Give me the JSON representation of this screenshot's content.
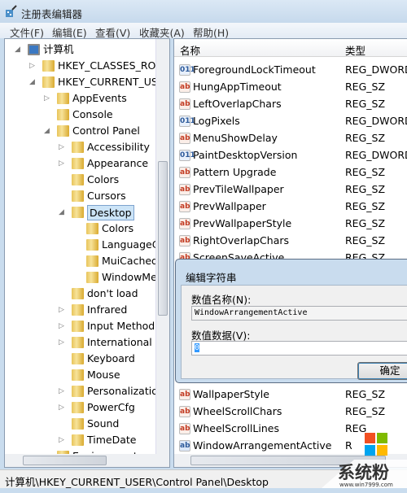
{
  "window": {
    "title": "注册表编辑器"
  },
  "menu": [
    "文件(F)",
    "编辑(E)",
    "查看(V)",
    "收藏夹(A)",
    "帮助(H)"
  ],
  "tree": [
    {
      "label": "计算机",
      "level": 0,
      "toggle": "◢",
      "icon": "computer"
    },
    {
      "label": "HKEY_CLASSES_ROOT",
      "level": 1,
      "toggle": "▷"
    },
    {
      "label": "HKEY_CURRENT_USER",
      "level": 1,
      "toggle": "◢"
    },
    {
      "label": "AppEvents",
      "level": 2,
      "toggle": "▷"
    },
    {
      "label": "Console",
      "level": 2,
      "toggle": ""
    },
    {
      "label": "Control Panel",
      "level": 2,
      "toggle": "◢"
    },
    {
      "label": "Accessibility",
      "level": 3,
      "toggle": "▷"
    },
    {
      "label": "Appearance",
      "level": 3,
      "toggle": "▷"
    },
    {
      "label": "Colors",
      "level": 3,
      "toggle": ""
    },
    {
      "label": "Cursors",
      "level": 3,
      "toggle": ""
    },
    {
      "label": "Desktop",
      "level": 3,
      "toggle": "◢",
      "selected": true
    },
    {
      "label": "Colors",
      "level": 4,
      "toggle": ""
    },
    {
      "label": "LanguageConfiguration",
      "level": 4,
      "toggle": ""
    },
    {
      "label": "MuiCached",
      "level": 4,
      "toggle": ""
    },
    {
      "label": "WindowMetrics",
      "level": 4,
      "toggle": ""
    },
    {
      "label": "don't load",
      "level": 3,
      "toggle": ""
    },
    {
      "label": "Infrared",
      "level": 3,
      "toggle": "▷"
    },
    {
      "label": "Input Method",
      "level": 3,
      "toggle": "▷"
    },
    {
      "label": "International",
      "level": 3,
      "toggle": "▷"
    },
    {
      "label": "Keyboard",
      "level": 3,
      "toggle": ""
    },
    {
      "label": "Mouse",
      "level": 3,
      "toggle": ""
    },
    {
      "label": "Personalization",
      "level": 3,
      "toggle": "▷"
    },
    {
      "label": "PowerCfg",
      "level": 3,
      "toggle": "▷"
    },
    {
      "label": "Sound",
      "level": 3,
      "toggle": ""
    },
    {
      "label": "TimeDate",
      "level": 3,
      "toggle": "▷"
    },
    {
      "label": "Environment",
      "level": 2,
      "toggle": ""
    }
  ],
  "list": {
    "headers": [
      "名称",
      "类型"
    ],
    "rows": [
      {
        "name": "ForegroundLockTimeout",
        "type": "REG_DWORD",
        "icon": "binary"
      },
      {
        "name": "HungAppTimeout",
        "type": "REG_SZ",
        "icon": "string"
      },
      {
        "name": "LeftOverlapChars",
        "type": "REG_SZ",
        "icon": "string"
      },
      {
        "name": "LogPixels",
        "type": "REG_DWORD",
        "icon": "binary"
      },
      {
        "name": "MenuShowDelay",
        "type": "REG_SZ",
        "icon": "string"
      },
      {
        "name": "PaintDesktopVersion",
        "type": "REG_DWORD",
        "icon": "binary"
      },
      {
        "name": "Pattern Upgrade",
        "type": "REG_SZ",
        "icon": "string"
      },
      {
        "name": "PrevTileWallpaper",
        "type": "REG_SZ",
        "icon": "string"
      },
      {
        "name": "PrevWallpaper",
        "type": "REG_SZ",
        "icon": "string"
      },
      {
        "name": "PrevWallpaperStyle",
        "type": "REG_SZ",
        "icon": "string"
      },
      {
        "name": "RightOverlapChars",
        "type": "REG_SZ",
        "icon": "string"
      },
      {
        "name": "ScreenSaveActive",
        "type": "REG_SZ",
        "icon": "string"
      }
    ],
    "rows_after": [
      {
        "name": "WallpaperStyle",
        "type": "REG_SZ",
        "icon": "string"
      },
      {
        "name": "WheelScrollChars",
        "type": "REG_SZ",
        "icon": "string"
      },
      {
        "name": "WheelScrollLines",
        "type": "REG",
        "icon": "string"
      },
      {
        "name": "WindowArrangementActive",
        "type": "R",
        "icon": "string-new"
      }
    ]
  },
  "dialog": {
    "title": "编辑字符串",
    "name_label": "数值名称(N):",
    "name_value": "WindowArrangementActive",
    "data_label": "数值数据(V):",
    "data_value": "0",
    "ok": "确定"
  },
  "status": "计算机\\HKEY_CURRENT_USER\\Control Panel\\Desktop",
  "watermark": {
    "text": "系统粉",
    "url": "www.win7999.com",
    "colors": [
      "#f25022",
      "#7fba00",
      "#00a4ef",
      "#ffb900"
    ]
  }
}
